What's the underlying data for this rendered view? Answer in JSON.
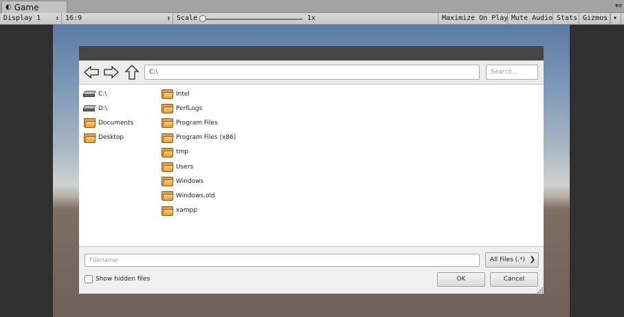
{
  "tab": {
    "title": "Game"
  },
  "toolbar": {
    "display": "Display 1",
    "aspect": "16:9",
    "scale_label": "Scale",
    "scale_value": "1x",
    "scale_fraction": 0.0,
    "maximize_on_play": "Maximize On Play",
    "mute_audio": "Mute Audio",
    "stats": "Stats",
    "gizmos": "Gizmos"
  },
  "dialog": {
    "path": "C:\\",
    "search_placeholder": "Search...",
    "drives": [
      {
        "label": "C:\\",
        "icon": "drive-icon"
      },
      {
        "label": "D:\\",
        "icon": "drive-icon"
      },
      {
        "label": "Documents",
        "icon": "folder-icon"
      },
      {
        "label": "Desktop",
        "icon": "folder-icon"
      }
    ],
    "files": [
      {
        "label": "Intel"
      },
      {
        "label": "PerfLogs"
      },
      {
        "label": "Program Files"
      },
      {
        "label": "Program Files (x86)"
      },
      {
        "label": "tmp"
      },
      {
        "label": "Users"
      },
      {
        "label": "Windows"
      },
      {
        "label": "Windows.old"
      },
      {
        "label": "xampp"
      }
    ],
    "filename_placeholder": "Filename",
    "filter": "All Files (.*)",
    "show_hidden": "Show hidden files",
    "ok": "OK",
    "cancel": "Cancel"
  }
}
